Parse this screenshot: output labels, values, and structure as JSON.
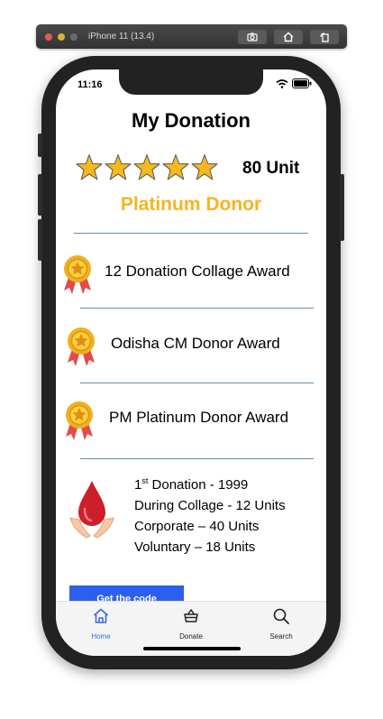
{
  "simulator": {
    "title": "iPhone 11 (13.4)"
  },
  "status_bar": {
    "time": "11:16"
  },
  "header": {
    "title": "My Donation"
  },
  "rating": {
    "stars": 5,
    "units_label": "80 Unit",
    "level": "Platinum Donor",
    "star_color": "#f6b81c"
  },
  "awards": [
    {
      "label": "12 Donation Collage Award"
    },
    {
      "label": "Odisha CM Donor Award"
    },
    {
      "label": "PM Platinum Donor Award"
    }
  ],
  "stats": {
    "first_prefix": "1",
    "first_sup": "st",
    "first_rest": " Donation - 1999",
    "line2": "During Collage - 12 Units",
    "line3": "Corporate – 40 Units",
    "line4": "Voluntary – 18 Units"
  },
  "cta": {
    "label": "Get the code"
  },
  "tabs": [
    {
      "label": "Home",
      "icon": "home-icon",
      "active": true
    },
    {
      "label": "Donate",
      "icon": "basket-icon",
      "active": false
    },
    {
      "label": "Search",
      "icon": "search-icon",
      "active": false
    }
  ],
  "colors": {
    "accent": "#2c5ff0",
    "level": "#f5b520",
    "active_tab": "#3a6be0"
  }
}
